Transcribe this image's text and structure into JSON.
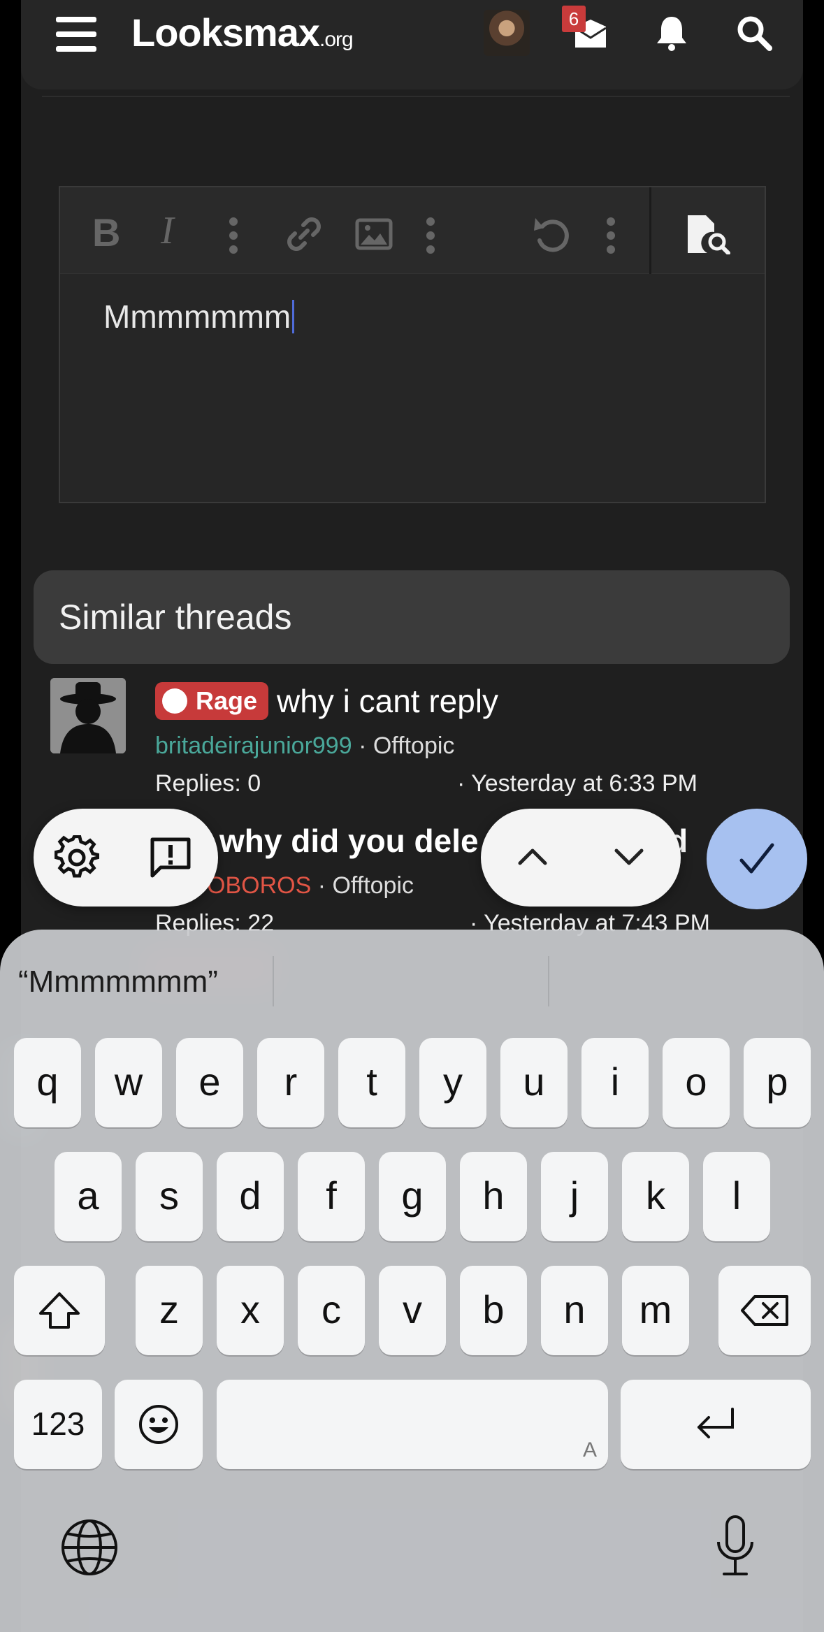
{
  "header": {
    "logo_main": "Looksmax",
    "logo_suffix": ".org",
    "conversations_badge": "6"
  },
  "editor": {
    "text": "Mmmmmmm",
    "toolbar": {
      "bold_label": "B",
      "italic_label": "I"
    }
  },
  "similar_threads": {
    "title": "Similar threads",
    "threads": [
      {
        "prefix": "Rage",
        "title": "why i cant reply",
        "author": "britadeirajunior999",
        "forum": "· Offtopic",
        "replies": "Replies: 0",
        "date": "· Yesterday at 6:33 PM"
      },
      {
        "title": "why did you dele",
        "title_tail": "d",
        "author": "OBOROS",
        "forum": "· Offtopic",
        "replies": "Replies: 22",
        "date": "· Yesterday at 7:43 PM"
      }
    ]
  },
  "keyboard": {
    "suggestion": "“Mmmmmmm”",
    "row1": [
      "q",
      "w",
      "e",
      "r",
      "t",
      "y",
      "u",
      "i",
      "o",
      "p"
    ],
    "row2": [
      "a",
      "s",
      "d",
      "f",
      "g",
      "h",
      "j",
      "k",
      "l"
    ],
    "row3": [
      "z",
      "x",
      "c",
      "v",
      "b",
      "n",
      "m"
    ],
    "numbers_label": "123",
    "space_hint": "A"
  },
  "colors": {
    "background": "#1f1f1f",
    "rage_prefix": "#c73a3a",
    "username_teal": "#4aa89a",
    "username_red": "#e15545",
    "confirm_button": "#a7c1f0"
  }
}
